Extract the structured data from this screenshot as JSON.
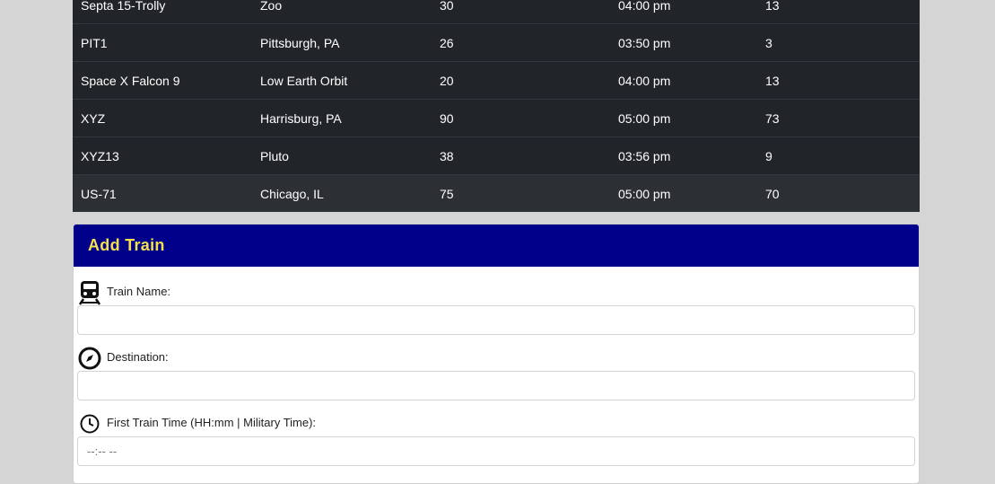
{
  "trains": {
    "rows": [
      {
        "name": "Septa 15-Trolly",
        "destination": "Zoo",
        "frequency": "30",
        "next_arrival": "04:00 pm",
        "minutes_away": "13"
      },
      {
        "name": "PIT1",
        "destination": "Pittsburgh, PA",
        "frequency": "26",
        "next_arrival": "03:50 pm",
        "minutes_away": "3"
      },
      {
        "name": "Space X Falcon 9",
        "destination": "Low Earth Orbit",
        "frequency": "20",
        "next_arrival": "04:00 pm",
        "minutes_away": "13"
      },
      {
        "name": "XYZ",
        "destination": "Harrisburg, PA",
        "frequency": "90",
        "next_arrival": "05:00 pm",
        "minutes_away": "73"
      },
      {
        "name": "XYZ13",
        "destination": "Pluto",
        "frequency": "38",
        "next_arrival": "03:56 pm",
        "minutes_away": "9"
      },
      {
        "name": "US-71",
        "destination": "Chicago, IL",
        "frequency": "75",
        "next_arrival": "05:00 pm",
        "minutes_away": "70"
      }
    ]
  },
  "add_train": {
    "title": "Add Train",
    "train_name_label": "Train Name:",
    "destination_label": "Destination:",
    "first_time_label": "First Train Time (HH:mm | Military Time):",
    "first_time_value": "--:-- --",
    "icons": {
      "train": "train-icon",
      "destination": "compass-icon",
      "time": "clock-icon"
    },
    "header_bg": "#00008b",
    "header_text": "#f4e04d"
  }
}
